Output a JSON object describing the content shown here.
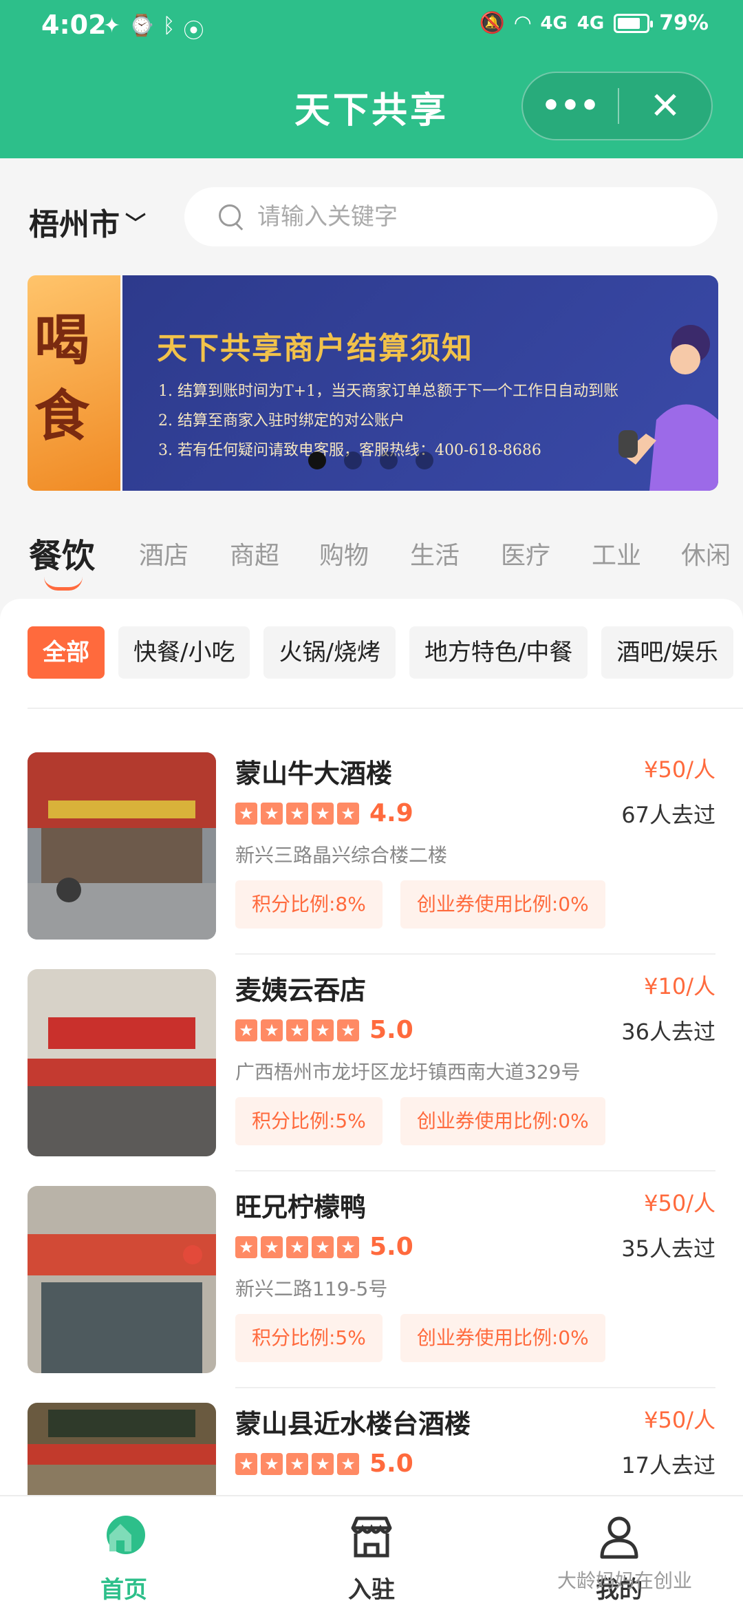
{
  "status_bar": {
    "time": "4:02",
    "battery": "79%",
    "signal1": "4G",
    "signal2": "4G"
  },
  "header": {
    "title": "天下共享",
    "more_label": "•••",
    "close_label": "✕"
  },
  "city": {
    "label": "梧州市"
  },
  "search": {
    "placeholder": "请输入关键字"
  },
  "banner": {
    "side_text": "喝\n食",
    "title": "天下共享商户结算须知",
    "lines": [
      "1. 结算到账时间为T+1，当天商家订单总额于下一个工作日自动到账",
      "2. 结算至商家入驻时绑定的对公账户",
      "3. 若有任何疑问请致电客服，客服热线：400-618-8686"
    ],
    "page_count": 4,
    "active_index": 0
  },
  "categories": [
    "餐饮",
    "酒店",
    "商超",
    "购物",
    "生活",
    "医疗",
    "工业",
    "休闲"
  ],
  "subcategories": [
    "全部",
    "快餐/小吃",
    "火锅/烧烤",
    "地方特色/中餐",
    "酒吧/娱乐"
  ],
  "stores": [
    {
      "name": "蒙山牛大酒楼",
      "price": "¥50/人",
      "rating": "4.9",
      "visits": "67人去过",
      "address": "新兴三路晶兴综合楼二楼",
      "tag1": "积分比例:8%",
      "tag2": "创业券使用比例:0%"
    },
    {
      "name": "麦姨云吞店",
      "price": "¥10/人",
      "rating": "5.0",
      "visits": "36人去过",
      "address": "广西梧州市龙圩区龙圩镇西南大道329号",
      "tag1": "积分比例:5%",
      "tag2": "创业券使用比例:0%"
    },
    {
      "name": "旺兄柠檬鸭",
      "price": "¥50/人",
      "rating": "5.0",
      "visits": "35人去过",
      "address": "新兴二路119-5号",
      "tag1": "积分比例:5%",
      "tag2": "创业券使用比例:0%"
    },
    {
      "name": "蒙山县近水楼台酒楼",
      "price": "¥50/人",
      "rating": "5.0",
      "visits": "17人去过",
      "address": "",
      "tag1": "",
      "tag2": ""
    }
  ],
  "nav": {
    "home": "首页",
    "join": "入驻",
    "mine": "我的"
  },
  "watermark": "大龄妈妈在创业",
  "colors": {
    "brand_green": "#2dbf8a",
    "accent_orange": "#ff6a3d"
  }
}
